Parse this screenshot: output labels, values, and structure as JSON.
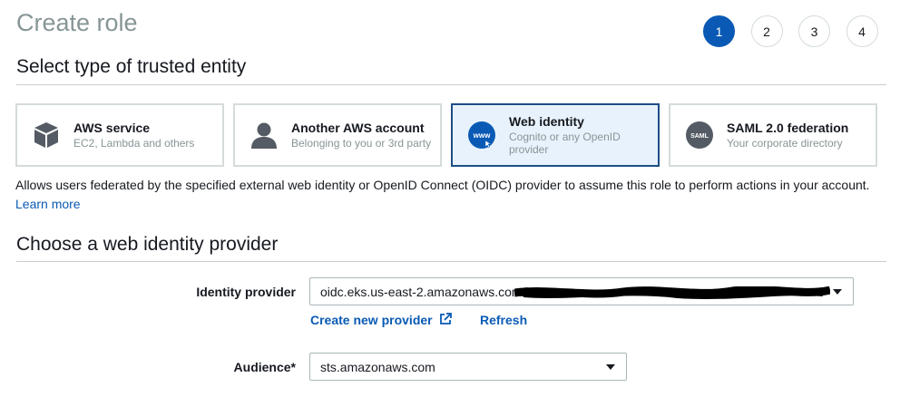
{
  "header": {
    "title": "Create role"
  },
  "steps": [
    {
      "label": "1",
      "active": true
    },
    {
      "label": "2",
      "active": false
    },
    {
      "label": "3",
      "active": false
    },
    {
      "label": "4",
      "active": false
    }
  ],
  "trusted_entity": {
    "section_title": "Select type of trusted entity",
    "options": [
      {
        "name": "AWS service",
        "sub": "EC2, Lambda and others",
        "icon": "cube-icon",
        "selected": false
      },
      {
        "name": "Another AWS account",
        "sub": "Belonging to you or 3rd party",
        "icon": "user-icon",
        "selected": false
      },
      {
        "name": "Web identity",
        "sub": "Cognito or any OpenID provider",
        "sub_line1": "Cognito or any OpenID",
        "sub_line2": "provider",
        "icon": "www-icon",
        "selected": true
      },
      {
        "name": "SAML 2.0 federation",
        "sub": "Your corporate directory",
        "icon": "saml-icon",
        "selected": false
      }
    ],
    "description": "Allows users federated by the specified external web identity or OpenID Connect (OIDC) provider to assume this role to perform actions in your account.",
    "learn_more": "Learn more"
  },
  "provider": {
    "section_title": "Choose a web identity provider",
    "identity_label": "Identity provider",
    "identity_value": "oidc.eks.us-east-2.amazonaws.com/id/",
    "create_provider": "Create new provider",
    "refresh": "Refresh",
    "audience_label": "Audience*",
    "audience_value": "sts.amazonaws.com"
  },
  "www_icon_text": "www",
  "saml_icon_text": "SAML",
  "colors": {
    "accent": "#0a5ab5",
    "selected_border": "#1d4e86",
    "selected_bg": "#e8f2fc",
    "muted": "#879596"
  }
}
